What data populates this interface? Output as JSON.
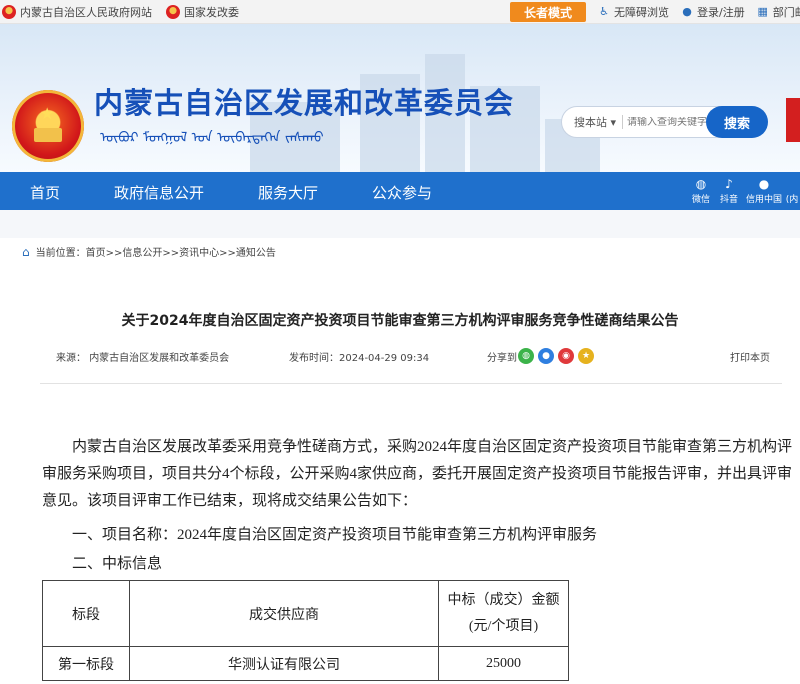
{
  "topbar": {
    "gov_site": "内蒙古自治区人民政府网站",
    "ndrc": "国家发改委",
    "elder_mode": "长者模式",
    "accessible": "无障碍浏览",
    "login": "登录/注册",
    "dept_mail": "部门邮箱"
  },
  "banner": {
    "title": "内蒙古自治区发展和改革委员会",
    "mongol_script": "ᠥᠪᠦᠷ ᠮᠣᠩᠭᠣᠯ ᠤᠨ ᠥᠪᠡᠷᠲᠡᠭᠡᠨ ᠵᠠᠰᠠᠬᠤ"
  },
  "search": {
    "scope": "搜本站",
    "placeholder": "请输入查询关键字",
    "button": "搜索"
  },
  "nav": {
    "items": [
      "首页",
      "政府信息公开",
      "服务大厅",
      "公众参与"
    ],
    "social": [
      "微信",
      "抖音",
      "信用中国",
      "(内"
    ]
  },
  "breadcrumb": {
    "label": "当前位置：",
    "path": "首页>>信息公开>>资讯中心>>通知公告"
  },
  "article": {
    "title": "关于2024年度自治区固定资产投资项目节能审查第三方机构评审服务竞争性磋商结果公告",
    "source_label": "来源：",
    "source": "内蒙古自治区发展和改革委员会",
    "publish_label": "发布时间：",
    "publish_time": "2024-04-29 09:34",
    "share_label": "分享到",
    "print": "打印本页",
    "intro": "内蒙古自治区发展改革委采用竞争性磋商方式，采购2024年度自治区固定资产投资项目节能审查第三方机构评审服务采购项目，项目共分4个标段，公开采购4家供应商，委托开展固定资产投资项目节能报告评审，并出具评审意见。该项目评审工作已结束，现将成交结果公告如下：",
    "project_line": "一、项目名称：2024年度自治区固定资产投资项目节能审查第三方机构评审服务",
    "winning_line": "二、中标信息"
  },
  "table": {
    "headers": [
      "标段",
      "成交供应商",
      "中标（成交）金额",
      "(元/个项目)"
    ],
    "rows": [
      {
        "lot": "第一标段",
        "supplier": "华测认证有限公司",
        "amount": "25000"
      }
    ]
  },
  "colors": {
    "brand_blue": "#1f70cc",
    "title_blue": "#1650b8",
    "elder_orange": "#f08a1d"
  }
}
